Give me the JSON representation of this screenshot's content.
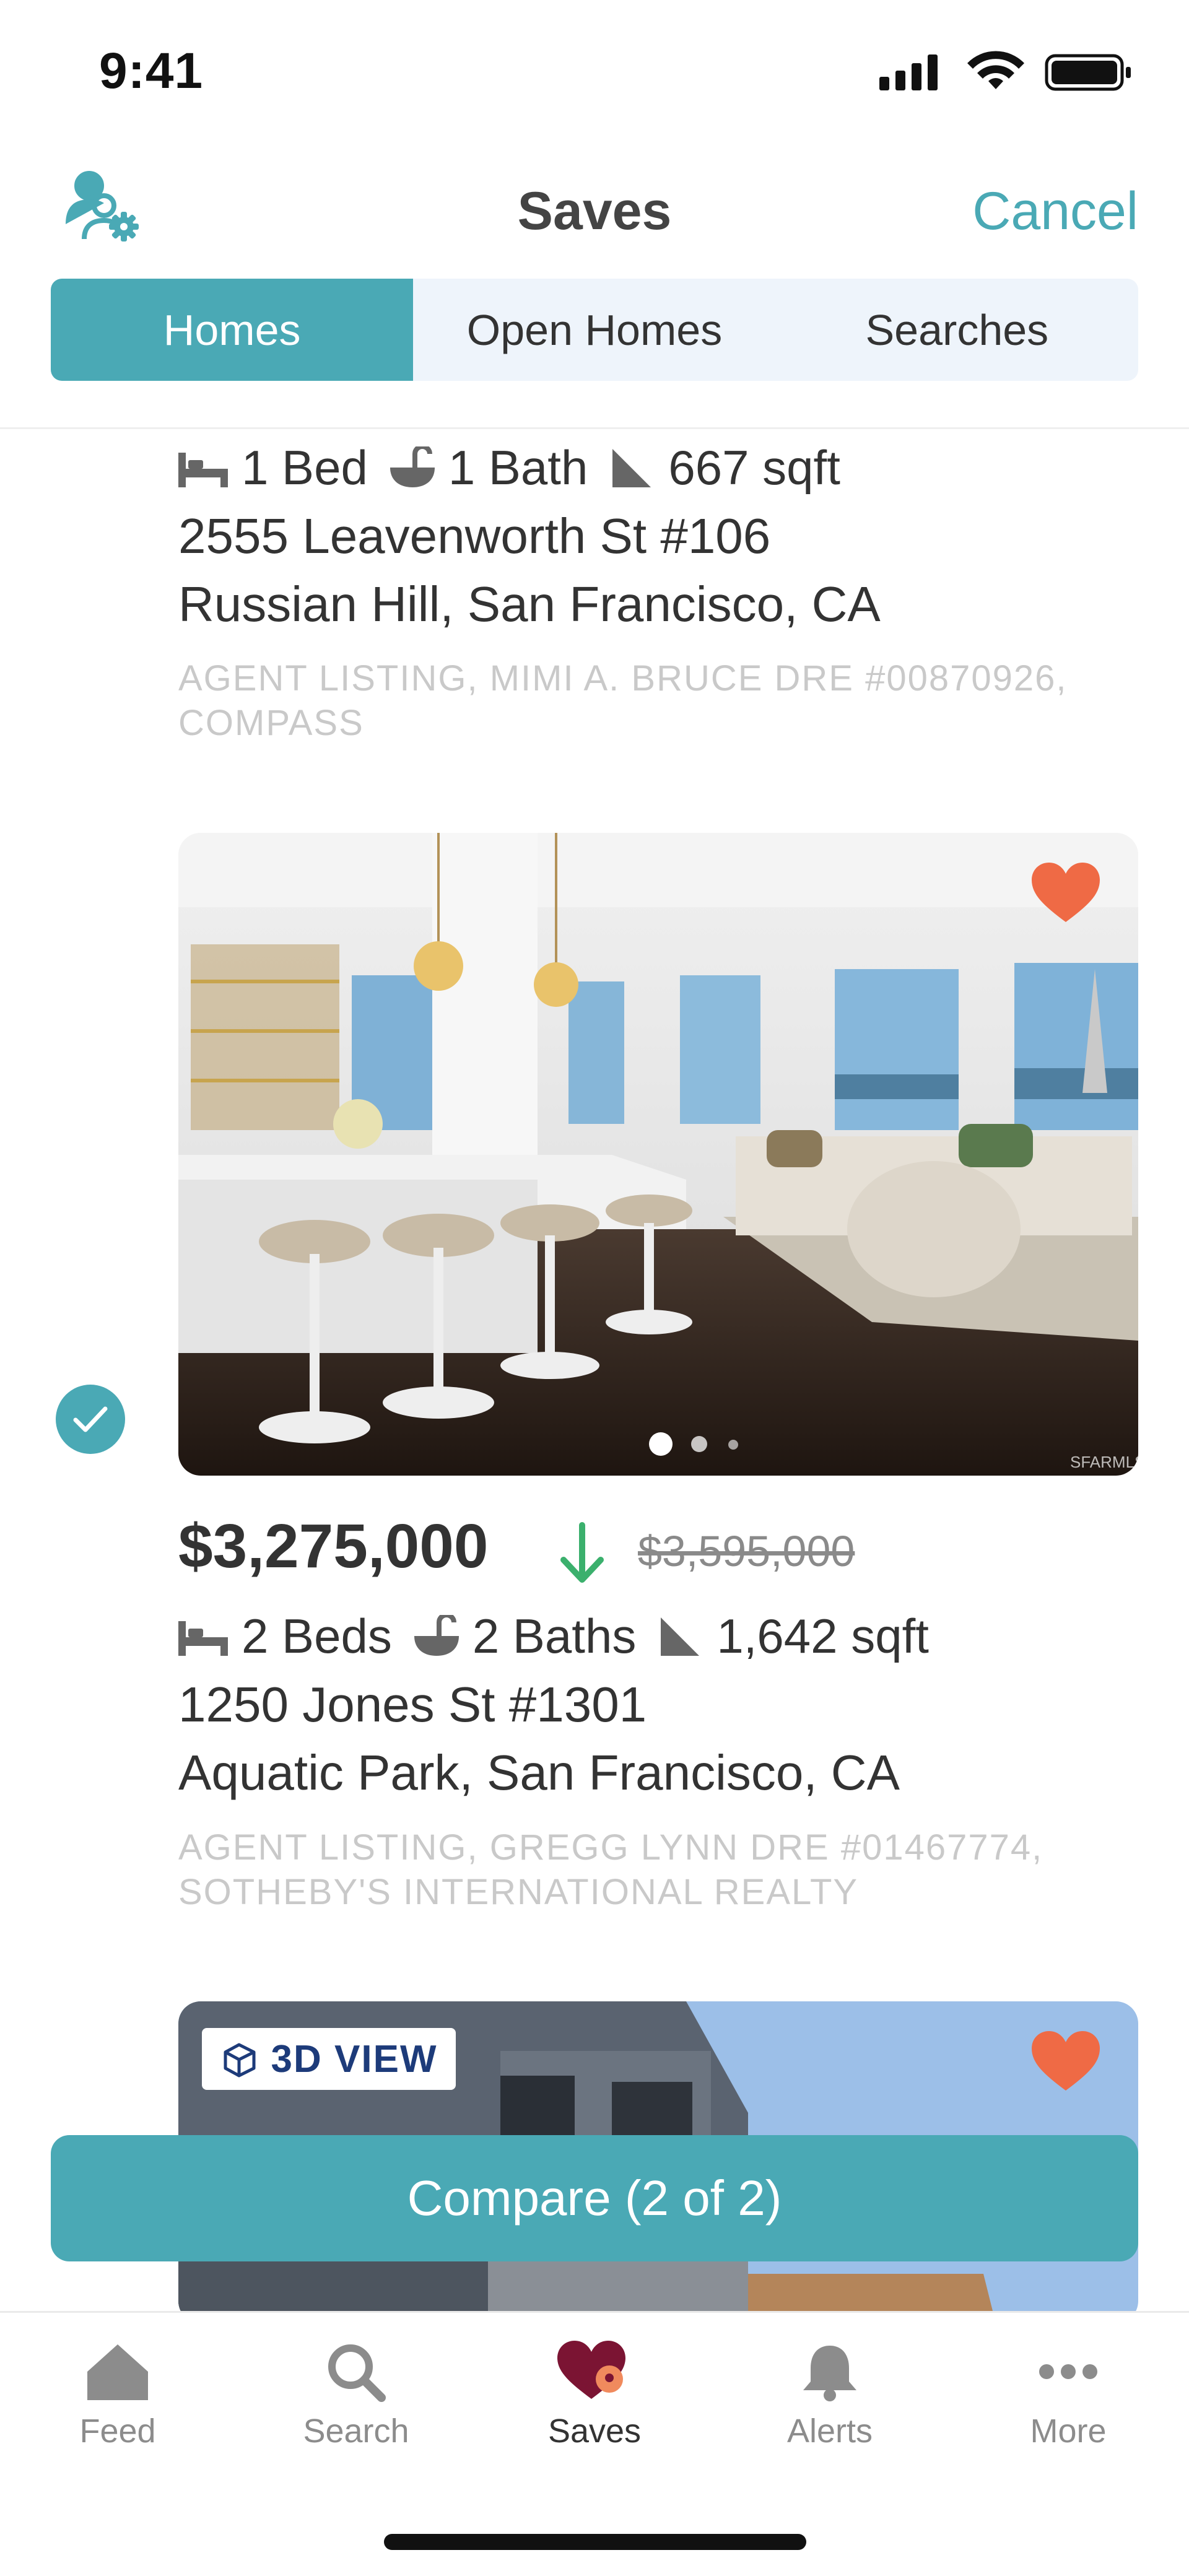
{
  "status_bar": {
    "time": "9:41"
  },
  "header": {
    "title": "Saves",
    "cancel_label": "Cancel",
    "profile_icon": "user-gear-icon"
  },
  "segments": [
    {
      "label": "Homes",
      "active": true
    },
    {
      "label": "Open Homes",
      "active": false
    },
    {
      "label": "Searches",
      "active": false
    }
  ],
  "listings": [
    {
      "beds": "1 Bed",
      "baths": "1 Bath",
      "sqft": "667 sqft",
      "address_line1": "2555 Leavenworth St #106",
      "address_line2": "Russian Hill, San Francisco, CA",
      "agent": "AGENT LISTING, MIMI A. BRUCE DRE #00870926, COMPASS"
    },
    {
      "selected": true,
      "favorited": true,
      "photo_count": 3,
      "active_photo_index": 1,
      "watermark": "SFARMLS",
      "price": "$3,275,000",
      "previous_price": "$3,595,000",
      "price_trend": "down",
      "beds": "2 Beds",
      "baths": "2 Baths",
      "sqft": "1,642 sqft",
      "address_line1": "1250 Jones St #1301",
      "address_line2": "Aquatic Park, San Francisco, CA",
      "agent": "AGENT LISTING, GREGG LYNN DRE #01467774, SOTHEBY'S INTERNATIONAL REALTY"
    },
    {
      "favorited": true,
      "badge": "3D VIEW"
    }
  ],
  "compare_button": {
    "label": "Compare (2 of 2)"
  },
  "tabbar": [
    {
      "label": "Feed",
      "icon": "home-icon",
      "active": false
    },
    {
      "label": "Search",
      "icon": "search-icon",
      "active": false
    },
    {
      "label": "Saves",
      "icon": "heart-icon",
      "active": true
    },
    {
      "label": "Alerts",
      "icon": "bell-icon",
      "active": false
    },
    {
      "label": "More",
      "icon": "more-icon",
      "active": false
    }
  ],
  "colors": {
    "accent": "#4aa9b5",
    "heart": "#ef6a45",
    "price_down": "#3bb06d",
    "saves_active": "#7b1433"
  }
}
